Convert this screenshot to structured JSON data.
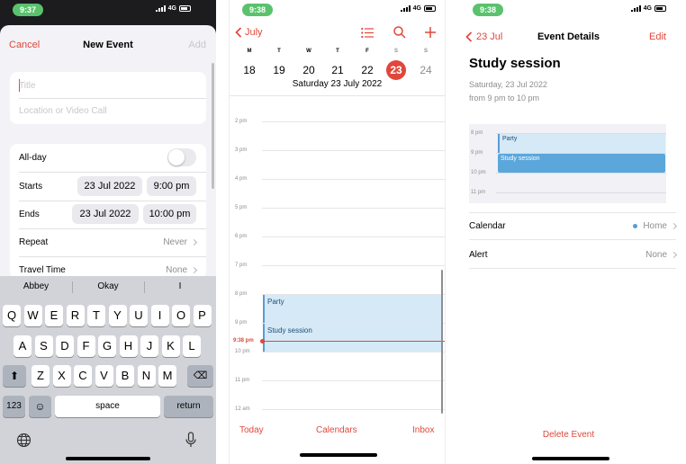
{
  "screen1": {
    "status": {
      "time": "9:37",
      "network": "4G"
    },
    "nav": {
      "cancel": "Cancel",
      "title": "New Event",
      "add": "Add"
    },
    "title_placeholder": "Title",
    "location_placeholder": "Location or Video Call",
    "all_day": {
      "label": "All-day",
      "on": false
    },
    "starts": {
      "label": "Starts",
      "date": "23 Jul 2022",
      "time": "9:00 pm"
    },
    "ends": {
      "label": "Ends",
      "date": "23 Jul 2022",
      "time": "10:00 pm"
    },
    "repeat": {
      "label": "Repeat",
      "value": "Never"
    },
    "travel_time": {
      "label": "Travel Time",
      "value": "None"
    },
    "keyboard": {
      "suggestions": [
        "Abbey",
        "Okay",
        "I"
      ],
      "row1": [
        "Q",
        "W",
        "E",
        "R",
        "T",
        "Y",
        "U",
        "I",
        "O",
        "P"
      ],
      "row2": [
        "A",
        "S",
        "D",
        "F",
        "G",
        "H",
        "J",
        "K",
        "L"
      ],
      "row3": [
        "Z",
        "X",
        "C",
        "V",
        "B",
        "N",
        "M"
      ],
      "numbers_key": "123",
      "space": "space",
      "return": "return"
    }
  },
  "screen2": {
    "status": {
      "time": "9:38",
      "network": "4G"
    },
    "back": "July",
    "weekdays": [
      "M",
      "T",
      "W",
      "T",
      "F",
      "S",
      "S"
    ],
    "dates": [
      "18",
      "19",
      "20",
      "21",
      "22",
      "23",
      "24"
    ],
    "selected_date": "23",
    "date_heading": "Saturday  23 July 2022",
    "hours": [
      "2 pm",
      "3 pm",
      "4 pm",
      "5 pm",
      "6 pm",
      "7 pm",
      "8 pm",
      "9 pm",
      "10 pm",
      "11 pm",
      "12 am"
    ],
    "now_label": "9:38 pm",
    "events": [
      "Party",
      "Study session"
    ],
    "toolbar": {
      "today": "Today",
      "calendars": "Calendars",
      "inbox": "Inbox"
    }
  },
  "screen3": {
    "status": {
      "time": "9:38",
      "network": "4G"
    },
    "nav": {
      "back": "23 Jul",
      "title": "Event Details",
      "edit": "Edit"
    },
    "event_title": "Study session",
    "date_line": "Saturday, 23 Jul 2022",
    "time_line": "from 9 pm to 10 pm",
    "mini_hours": [
      "8 pm",
      "9 pm",
      "10 pm",
      "11 pm"
    ],
    "mini_events": [
      "Party",
      "Study session"
    ],
    "calendar": {
      "label": "Calendar",
      "value": "Home",
      "color": "#5b9bd5"
    },
    "alert": {
      "label": "Alert",
      "value": "None"
    },
    "delete": "Delete Event"
  },
  "colors": {
    "accent": "#e0473b",
    "event_fill": "#d6e9f6",
    "event_selected": "#5ba7db",
    "status_pill": "#5ac26d"
  }
}
